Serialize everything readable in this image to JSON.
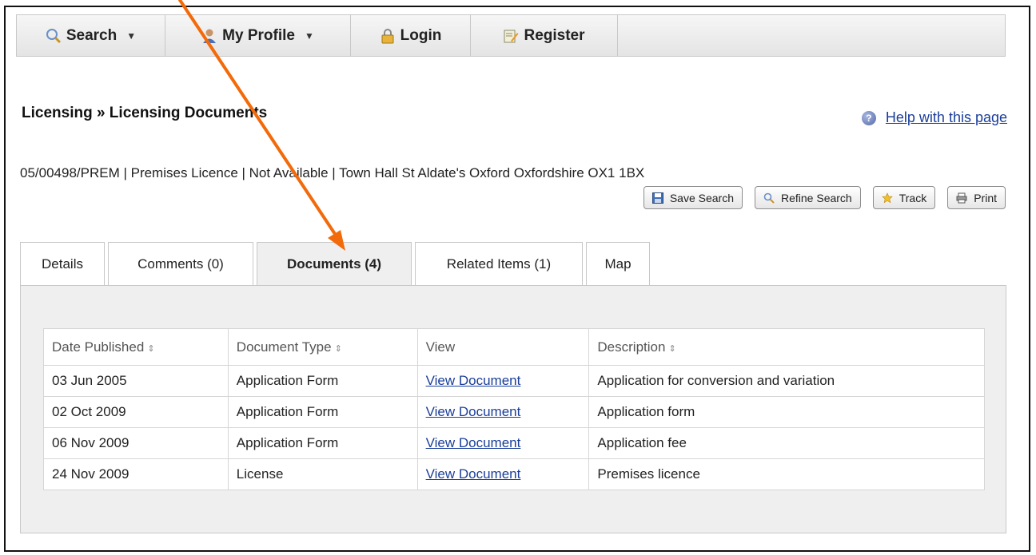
{
  "nav": {
    "search": "Search",
    "my_profile": "My Profile",
    "login": "Login",
    "register": "Register",
    "caret": "▼"
  },
  "page": {
    "title": "Licensing » Licensing Documents",
    "help_link": "Help with this page",
    "summary": "05/00498/PREM | Premises Licence | Not Available | Town Hall St Aldate's Oxford Oxfordshire OX1 1BX"
  },
  "actions": {
    "save_search": "Save Search",
    "refine_search": "Refine Search",
    "track": "Track",
    "print": "Print"
  },
  "tabs": {
    "details": "Details",
    "comments": "Comments (0)",
    "documents": "Documents (4)",
    "related": "Related Items (1)",
    "map": "Map"
  },
  "table": {
    "headers": {
      "date": "Date Published",
      "type": "Document Type",
      "view": "View",
      "description": "Description",
      "sort_glyph": "⇕"
    },
    "rows": [
      {
        "date": "03 Jun 2005",
        "type": "Application Form",
        "view": "View Document",
        "description": "Application for conversion and variation"
      },
      {
        "date": "02 Oct 2009",
        "type": "Application Form",
        "view": "View Document",
        "description": "Application form"
      },
      {
        "date": "06 Nov 2009",
        "type": "Application Form",
        "view": "View Document",
        "description": "Application fee"
      },
      {
        "date": "24 Nov 2009",
        "type": "License",
        "view": "View Document",
        "description": "Premises licence"
      }
    ]
  },
  "colors": {
    "arrow": "#f26a0a",
    "link": "#1a3e9a",
    "panel_bg": "#efefef"
  }
}
